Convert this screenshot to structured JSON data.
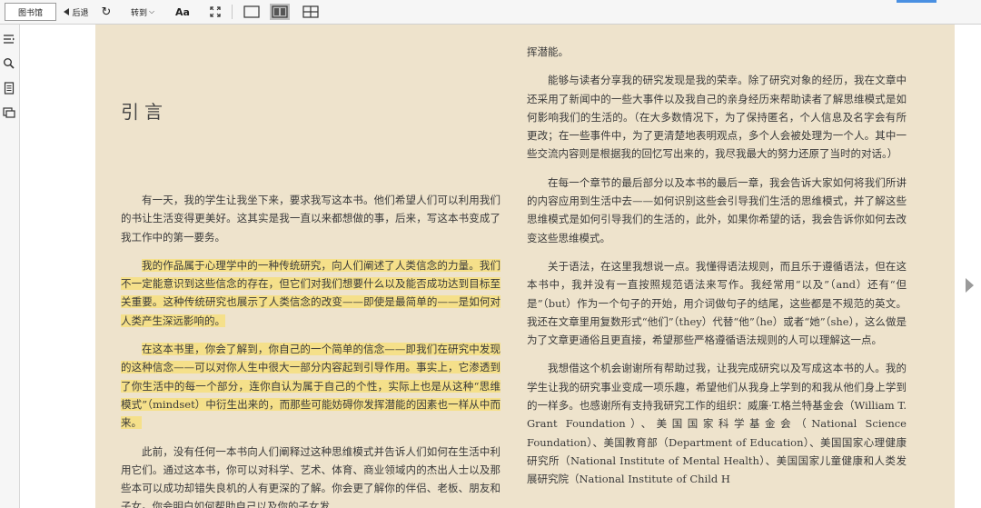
{
  "toolbar": {
    "library_label": "图书馆",
    "back_label": "后退",
    "goto_label": "转到",
    "font_label": "Aa"
  },
  "page": {
    "chapter_title": "引言",
    "left_paragraphs": [
      {
        "text": "有一天，我的学生让我坐下来，要求我写这本书。他们希望人们可以利用我们的书让生活变得更美好。这其实是我一直以来都想做的事，后来，写这本书变成了我工作中的第一要务。",
        "highlight": false
      },
      {
        "text": "我的作品属于心理学中的一种传统研究，向人们阐述了人类信念的力量。我们不一定能意识到这些信念的存在，但它们对我们想要什么以及能否成功达到目标至关重要。这种传统研究也展示了人类信念的改变——即使是最简单的——是如何对人类产生深远影响的。",
        "highlight": true
      },
      {
        "text": "在这本书里，你会了解到，你自己的一个简单的信念——即我们在研究中发现的这种信念——可以对你人生中很大一部分内容起到引导作用。事实上，它渗透到了你生活中的每一个部分，连你自认为属于自己的个性，实际上也是从这种“思维模式”（mindset）中衍生出来的，而那些可能妨碍你发挥潜能的因素也一样从中而来。",
        "highlight": true
      },
      {
        "text": "此前，没有任何一本书向人们阐释过这种思维模式并告诉人们如何在生活中利用它们。通过这本书，你可以对科学、艺术、体育、商业领域内的杰出人士以及那些本可以成功却错失良机的人有更深的了解。你会更了解你的伴侣、老板、朋友和子女。你会明白如何帮助自己以及你的子女发",
        "highlight": false
      }
    ],
    "right_paragraphs": [
      {
        "text": "挥潜能。",
        "indent": false
      },
      {
        "text": "能够与读者分享我的研究发现是我的荣幸。除了研究对象的经历，我在文章中还采用了新闻中的一些大事件以及我自己的亲身经历来帮助读者了解思维模式是如何影响我们的生活的。（在大多数情况下，为了保持匿名，个人信息及名字会有所更改；在一些事件中，为了更清楚地表明观点，多个人会被处理为一个人。其中一些交流内容则是根据我的回忆写出来的，我尽我最大的努力还原了当时的对话。）",
        "indent": true
      },
      {
        "text": "在每一个章节的最后部分以及本书的最后一章，我会告诉大家如何将我们所讲的内容应用到生活中去——如何识别这些会引导我们生活的思维模式，并了解这些思维模式是如何引导我们的生活的，此外，如果你希望的话，我会告诉你如何去改变这些思维模式。",
        "indent": true
      },
      {
        "text": "关于语法，在这里我想说一点。我懂得语法规则，而且乐于遵循语法，但在这本书中，我并没有一直按照规范语法来写作。我经常用“以及”（and）还有“但是”（but）作为一个句子的开始，用介词做句子的结尾，这些都是不规范的英文。我还在文章里用复数形式“他们”（they）代替“他”（he）或者“她”（she），这么做是为了文章更通俗且更直接，希望那些严格遵循语法规则的人可以理解这一点。",
        "indent": true
      },
      {
        "text": "我想借这个机会谢谢所有帮助过我，让我完成研究以及写成这本书的人。我的学生让我的研究事业变成一项乐趣，希望他们从我身上学到的和我从他们身上学到的一样多。也感谢所有支持我研究工作的组织：威廉·T.格兰特基金会（William T. Grant Foundation）、美国国家科学基金会（National Science Foundation）、美国教育部（Department of Education）、美国国家心理健康研究所（National Institute of Mental Health）、美国国家儿童健康和人类发展研究院（National Institute of Child H",
        "indent": true
      }
    ]
  },
  "colors": {
    "page_bg": "#eee3cc",
    "highlight": "#f5e08a",
    "accent": "#4a90e2"
  }
}
